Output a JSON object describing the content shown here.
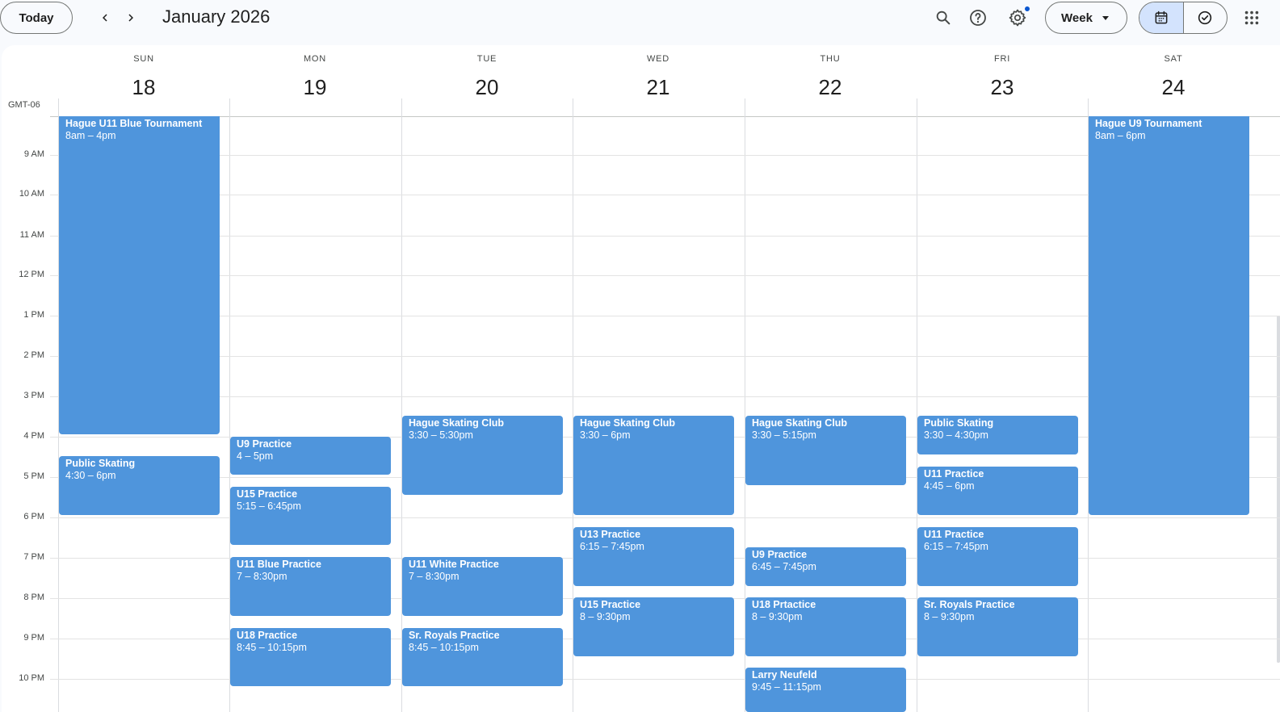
{
  "toolbar": {
    "today_label": "Today",
    "title": "January 2026",
    "view_label": "Week"
  },
  "calendar": {
    "timezone": "GMT-06",
    "days": [
      {
        "name": "SUN",
        "date": "18"
      },
      {
        "name": "MON",
        "date": "19"
      },
      {
        "name": "TUE",
        "date": "20"
      },
      {
        "name": "WED",
        "date": "21"
      },
      {
        "name": "THU",
        "date": "22"
      },
      {
        "name": "FRI",
        "date": "23"
      },
      {
        "name": "SAT",
        "date": "24"
      }
    ],
    "hours": [
      "9 AM",
      "10 AM",
      "11 AM",
      "12 PM",
      "1 PM",
      "2 PM",
      "3 PM",
      "4 PM",
      "5 PM",
      "6 PM",
      "7 PM",
      "8 PM",
      "9 PM",
      "10 PM"
    ],
    "events": [
      {
        "title": "Hague U11 Blue Tournament",
        "time": "8am – 4pm"
      },
      {
        "title": "Public Skating",
        "time": "4:30 – 6pm"
      },
      {
        "title": "U9 Practice",
        "time": "4 – 5pm"
      },
      {
        "title": "U15 Practice",
        "time": "5:15 – 6:45pm"
      },
      {
        "title": "U11 Blue Practice",
        "time": "7 – 8:30pm"
      },
      {
        "title": "U18 Practice",
        "time": "8:45 – 10:15pm"
      },
      {
        "title": "Hague Skating Club",
        "time": "3:30 – 5:30pm"
      },
      {
        "title": "U11 White Practice",
        "time": "7 – 8:30pm"
      },
      {
        "title": "Sr. Royals Practice",
        "time": "8:45 – 10:15pm"
      },
      {
        "title": "Hague Skating Club",
        "time": "3:30 – 6pm"
      },
      {
        "title": "U13 Practice",
        "time": "6:15 – 7:45pm"
      },
      {
        "title": "U15 Practice",
        "time": "8 – 9:30pm"
      },
      {
        "title": "Hague Skating Club",
        "time": "3:30 – 5:15pm"
      },
      {
        "title": "U9 Practice",
        "time": "6:45 – 7:45pm"
      },
      {
        "title": "U18 Prtactice",
        "time": "8 – 9:30pm"
      },
      {
        "title": "Larry Neufeld",
        "time": "9:45 – 11:15pm"
      },
      {
        "title": "Public Skating",
        "time": "3:30 – 4:30pm"
      },
      {
        "title": "U11 Practice",
        "time": "4:45 – 6pm"
      },
      {
        "title": "U11 Practice",
        "time": "6:15 – 7:45pm"
      },
      {
        "title": "Sr. Royals Practice",
        "time": "8 – 9:30pm"
      },
      {
        "title": "Hague U9 Tournament",
        "time": "8am – 6pm"
      }
    ]
  },
  "colors": {
    "event": "#4f95dc",
    "accent": "#0b57d0",
    "toggle_selected": "#d3e3fd"
  },
  "icons": {
    "prev": "chevron-left-icon",
    "next": "chevron-right-icon",
    "search": "search-icon",
    "help": "help-icon",
    "settings": "gear-icon",
    "view_caret": "caret-down-icon",
    "calendar": "calendar-icon",
    "tasks": "task-check-icon",
    "apps": "apps-grid-icon"
  }
}
